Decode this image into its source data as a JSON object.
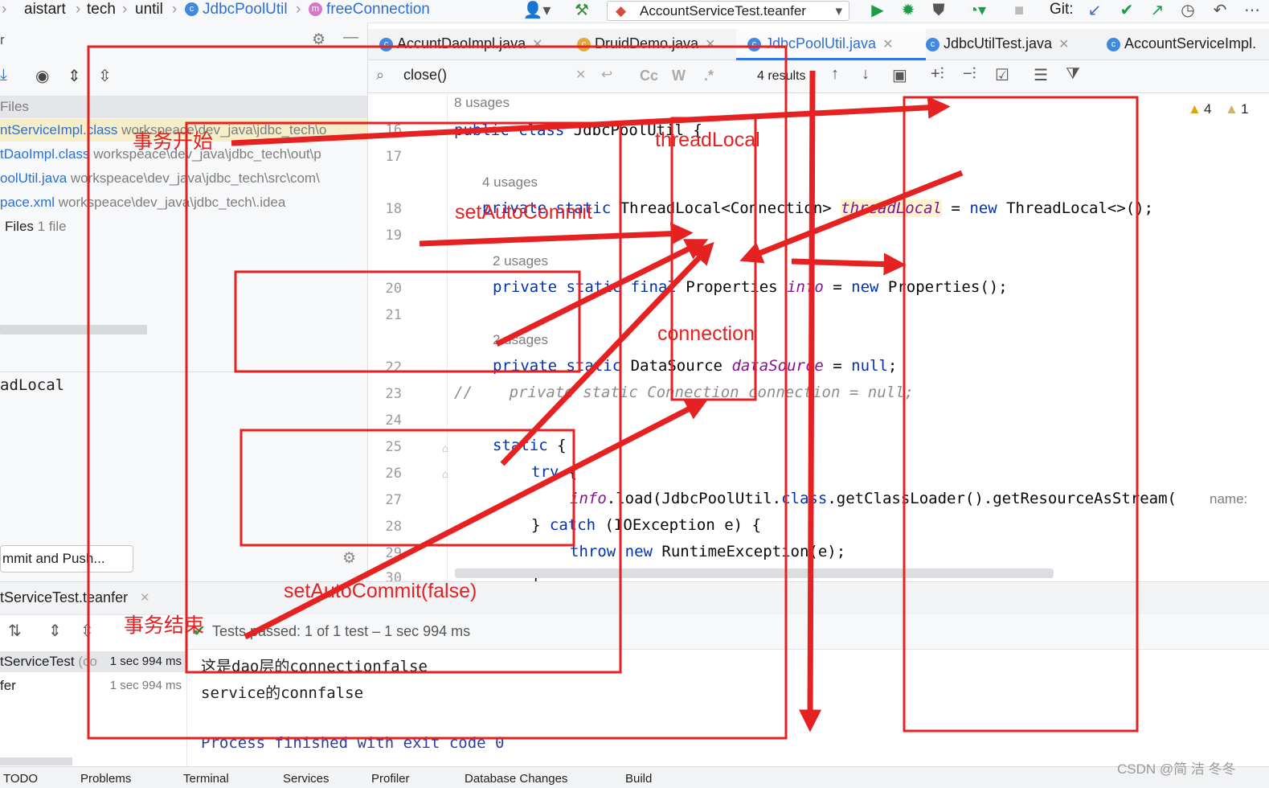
{
  "breadcrumb": [
    "aistart",
    "tech",
    "until",
    "JdbcPoolUtil",
    "freeConnection"
  ],
  "run_config": "AccountServiceTest.teanfer",
  "git_label": "Git:",
  "tabs": [
    "AccuntDaoImpl.java",
    "DruidDemo.java",
    "JdbcPoolUtil.java",
    "JdbcUtilTest.java",
    "AccountServiceImpl."
  ],
  "active_tab_index": 2,
  "search": {
    "query": "close()",
    "results": "4 results",
    "case_btn": "Cc",
    "word_btn": "W",
    "regex_btn": ".*"
  },
  "left_panel": {
    "section_label": "Files",
    "rows": [
      {
        "name": "ntServiceImpl.class",
        "path": "workspeace\\dev_java\\jdbc_tech\\o"
      },
      {
        "name": "tDaoImpl.class",
        "path": "workspeace\\dev_java\\jdbc_tech\\out\\p"
      },
      {
        "name": "oolUtil.java",
        "path": "workspeace\\dev_java\\jdbc_tech\\src\\com\\"
      },
      {
        "name": "pace.xml",
        "path": "workspeace\\dev_java\\jdbc_tech\\.idea"
      }
    ],
    "files_summary": "Files",
    "files_count": "1 file",
    "search_text": "adLocal",
    "commit_button": "mmit and Push..."
  },
  "editor": {
    "hints": [
      "8 usages",
      "4 usages",
      "2 usages",
      "2 usages"
    ],
    "line_numbers": [
      "16",
      "17",
      "18",
      "19",
      "20",
      "21",
      "22",
      "23",
      "24",
      "25",
      "26",
      "27",
      "28",
      "29",
      "30"
    ],
    "warnings": "4",
    "weak_warnings": "1",
    "param_hint": "name:"
  },
  "run_panel": {
    "tab": "tServiceTest.teanfer",
    "test_status": "Tests passed: 1 of 1 test – 1 sec 994 ms",
    "tree": [
      {
        "name": "tServiceTest",
        "extra": "(co",
        "time": "1 sec 994 ms"
      },
      {
        "name": "fer",
        "extra": "",
        "time": "1 sec 994 ms"
      }
    ],
    "output": [
      "这是dao层的connectionfalse",
      "service的connfalse",
      "",
      "Process finished with exit code 0"
    ]
  },
  "status_bar": [
    "TODO",
    "Problems",
    "Terminal",
    "Services",
    "Profiler",
    "Database Changes",
    "Build"
  ],
  "annotations": {
    "tx_start": "事务开始",
    "thread_local": "threadLocal",
    "set_auto_commit": "setAutoCommit",
    "connection": "connection",
    "set_auto_commit_false": "setAutoCommit(false)",
    "tx_end": "事务结束"
  },
  "watermark": "CSDN @简 洁 冬冬",
  "colors": {
    "annotation_red": "#e52121",
    "accent": "#3574f0",
    "keyword": "#0033b3",
    "field": "#871094"
  }
}
